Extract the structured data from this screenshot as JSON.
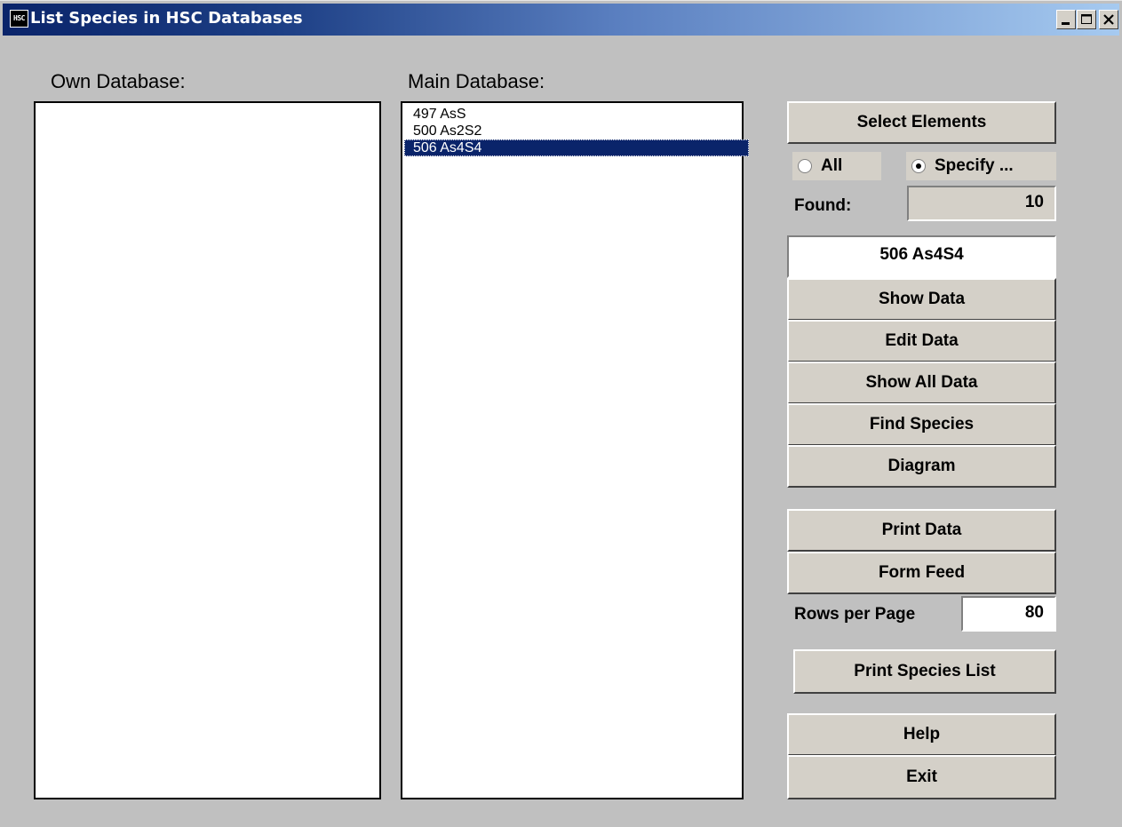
{
  "window": {
    "title": "List Species in HSC Databases",
    "icon_text": "HSC"
  },
  "own_database": {
    "label": "Own Database:",
    "items": []
  },
  "main_database": {
    "label": "Main Database:",
    "items": [
      "497 AsS",
      "500 As2S2",
      "506 As4S4"
    ],
    "selected_index": 2
  },
  "buttons": {
    "select_elements": "Select Elements",
    "show_data": "Show Data",
    "edit_data": "Edit Data",
    "show_all_data": "Show All Data",
    "find_species": "Find Species",
    "diagram": "Diagram",
    "print_data": "Print Data",
    "form_feed": "Form Feed",
    "print_species_list": "Print Species List",
    "help": "Help",
    "exit": "Exit"
  },
  "filter": {
    "all_label": "All",
    "specify_label": "Specify ...",
    "selected": "specify"
  },
  "found": {
    "label": "Found:",
    "value": "10"
  },
  "selected_species": "506  As4S4",
  "rows_per_page": {
    "label": "Rows per Page",
    "value": "80"
  }
}
